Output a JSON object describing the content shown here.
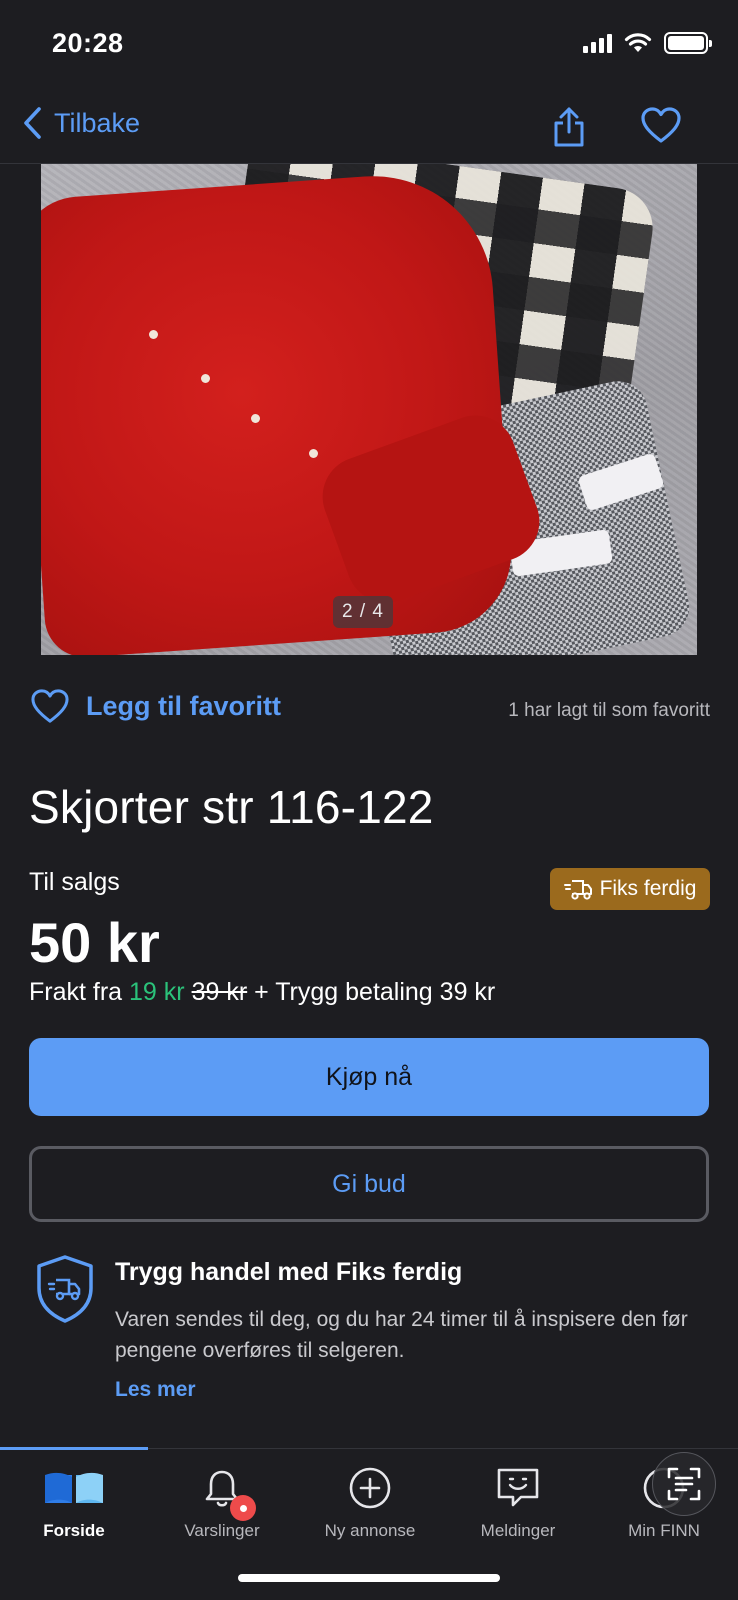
{
  "status_bar": {
    "time": "20:28"
  },
  "nav": {
    "back_label": "Tilbake"
  },
  "photo": {
    "counter": "2 / 4"
  },
  "favorite": {
    "label": "Legg til favoritt",
    "count_text": "1 har lagt til som favoritt"
  },
  "listing": {
    "title": "Skjorter str 116-122",
    "sale_label": "Til salgs",
    "badge": "Fiks ferdig",
    "price": "50 kr",
    "shipping_prefix": "Frakt fra",
    "shipping_discount": "19 kr",
    "shipping_original": "39 kr",
    "shipping_suffix": "+ Trygg betaling 39 kr"
  },
  "actions": {
    "buy": "Kjøp nå",
    "bid": "Gi bud"
  },
  "safe_trade": {
    "title": "Trygg handel med Fiks ferdig",
    "text": "Varen sendes til deg, og du har 24 timer til å inspisere den før pengene overføres til selgeren.",
    "link": "Les mer"
  },
  "tabs": [
    {
      "label": "Forside",
      "icon": "home-book-icon",
      "active": true
    },
    {
      "label": "Varslinger",
      "icon": "bell-icon"
    },
    {
      "label": "Ny annonse",
      "icon": "plus-circle-icon"
    },
    {
      "label": "Meldinger",
      "icon": "chat-icon"
    },
    {
      "label": "Min FINN",
      "icon": "user-icon"
    }
  ],
  "colors": {
    "background": "#1d1d21",
    "accent": "#5c9cf5",
    "badge": "#9b6a1d",
    "discount": "#2bc27a"
  }
}
